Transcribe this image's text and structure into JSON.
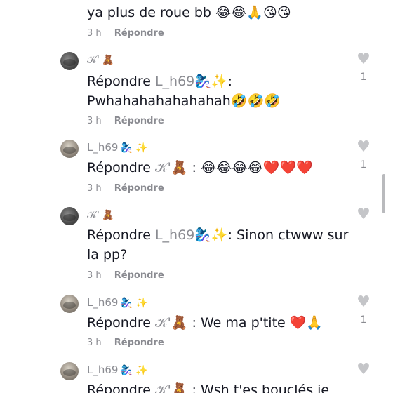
{
  "replies": [
    {
      "username": "",
      "badge": "",
      "mention": "",
      "text": "ya plus de roue bb 😂😂🙏😘😘",
      "time": "3 h",
      "reply_label": "Répondre",
      "likes": ""
    },
    {
      "username": "𝒦'",
      "badge": "🧸",
      "prefix": "Répondre ",
      "mention": "L_h69🧞‍♀️✨",
      "text": ": Pwhahahahahahahah🤣🤣🤣",
      "time": "3 h",
      "reply_label": "Répondre",
      "likes": "1"
    },
    {
      "username": "L_h69",
      "badge": "🧞‍♀️ ✨",
      "prefix": "Répondre ",
      "mention": "𝒦'🧸",
      "text": " : 😂😂😂😂❤️❤️❤️",
      "time": "3 h",
      "reply_label": "Répondre",
      "likes": "1"
    },
    {
      "username": "𝒦'",
      "badge": "🧸",
      "prefix": "Répondre ",
      "mention": "L_h69🧞‍♀️✨",
      "text": ": Sinon ctwww sur la pp?",
      "time": "3 h",
      "reply_label": "Répondre",
      "likes": ""
    },
    {
      "username": "L_h69",
      "badge": "🧞‍♀️ ✨",
      "prefix": "Répondre ",
      "mention": "𝒦'🧸",
      "text": " : We ma p'tite ❤️🙏",
      "time": "3 h",
      "reply_label": "Répondre",
      "likes": "1"
    },
    {
      "username": "L_h69",
      "badge": "🧞‍♀️ ✨",
      "prefix": "Répondre ",
      "mention": "𝒦'🧸",
      "text": " : Wsh t'es bouclés je",
      "time": "",
      "reply_label": "",
      "likes": ""
    }
  ],
  "icons": {
    "like": "heart-outline-icon"
  }
}
